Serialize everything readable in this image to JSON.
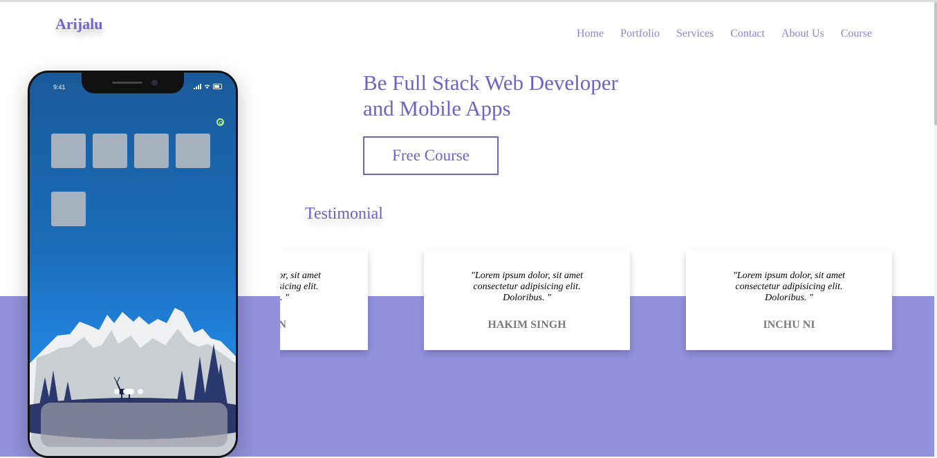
{
  "header": {
    "logo": "Arijalu",
    "nav": [
      "Home",
      "Portfolio",
      "Services",
      "Contact",
      "About Us",
      "Course"
    ]
  },
  "hero": {
    "title_line1": "Be Full Stack Web Developer",
    "title_line2": "and Mobile Apps",
    "cta_label": "Free Course"
  },
  "testimonial": {
    "heading": "Testimonial",
    "cards": [
      {
        "quote": "\"Lorem ipsum dolor, sit amet consectetur adipisicing elit. Doloribus. \"",
        "author": "HUMAN"
      },
      {
        "quote": "\"Lorem ipsum dolor, sit amet consectetur adipisicing elit. Doloribus. \"",
        "author": "HAKIM SINGH"
      },
      {
        "quote": "\"Lorem ipsum dolor, sit amet consectetur adipisicing elit. Doloribus. \"",
        "author": "INCHU NI"
      }
    ]
  },
  "phone": {
    "time": "9:41",
    "app_count": 5,
    "page_dots": 3,
    "active_page_dot": 2
  },
  "colors": {
    "accent": "#6c63c4",
    "nav_text": "#8a84d2",
    "band": "#9191dc",
    "author_text": "#7a7a7a"
  }
}
